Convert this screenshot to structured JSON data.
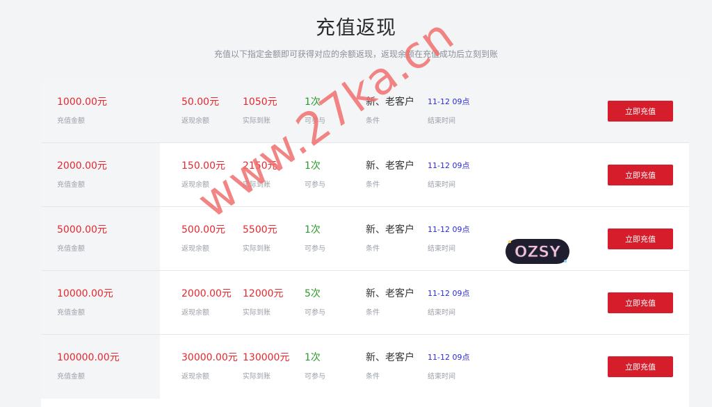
{
  "header": {
    "title": "充值返现",
    "subtitle": "充值以下指定金额即可获得对应的余额返现，返现余额在充值成功后立刻到账"
  },
  "labels": {
    "amount": "充值金额",
    "bonus": "返现余额",
    "actual": "实际到账",
    "times": "可参与",
    "condition": "条件",
    "end": "结束时间"
  },
  "button_label": "立即充值",
  "rows": [
    {
      "amount": "1000.00元",
      "bonus": "50.00元",
      "actual": "1050元",
      "times": "1次",
      "condition": "新、老客户",
      "end": "11-12 09点"
    },
    {
      "amount": "2000.00元",
      "bonus": "150.00元",
      "actual": "2150元",
      "times": "1次",
      "condition": "新、老客户",
      "end": "11-12 09点"
    },
    {
      "amount": "5000.00元",
      "bonus": "500.00元",
      "actual": "5500元",
      "times": "1次",
      "condition": "新、老客户",
      "end": "11-12 09点"
    },
    {
      "amount": "10000.00元",
      "bonus": "2000.00元",
      "actual": "12000元",
      "times": "5次",
      "condition": "新、老客户",
      "end": "11-12 09点"
    },
    {
      "amount": "100000.00元",
      "bonus": "30000.00元",
      "actual": "130000元",
      "times": "1次",
      "condition": "新、老客户",
      "end": "11-12 09点"
    }
  ],
  "watermark": "www.27ka.cn",
  "sticker": "OZSY",
  "colors": {
    "accent": "#d51d2c",
    "amount_red": "#e8262c",
    "times_green": "#2a9a2a",
    "time_blue": "#2a2ad6",
    "watermark": "#f06e6e"
  }
}
